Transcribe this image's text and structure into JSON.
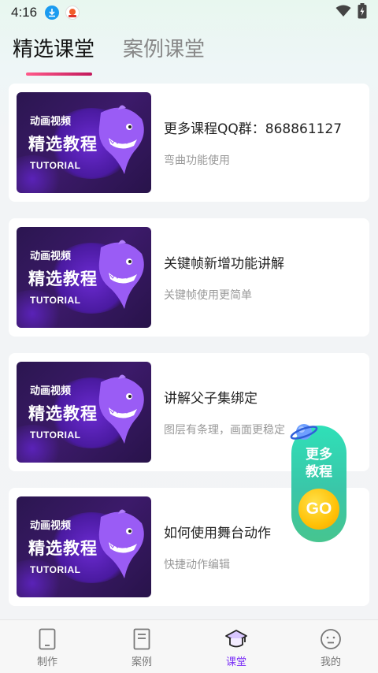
{
  "status_bar": {
    "time": "4:16",
    "icons": [
      "download-icon",
      "app-notification-icon",
      "wifi-icon",
      "battery-icon"
    ]
  },
  "tabs": [
    {
      "label": "精选课堂",
      "active": true
    },
    {
      "label": "案例课堂",
      "active": false
    }
  ],
  "thumbnail": {
    "line1": "动画视频",
    "line2": "精选教程",
    "line3": "TUTORIAL"
  },
  "courses": [
    {
      "title": "更多课程QQ群：868861127",
      "subtitle": "弯曲功能使用"
    },
    {
      "title": "关键帧新增功能讲解",
      "subtitle": "关键帧使用更简单"
    },
    {
      "title": "讲解父子集绑定",
      "subtitle": "图层有条理，画面更稳定"
    },
    {
      "title": "如何使用舞台动作",
      "subtitle": "快捷动作编辑"
    }
  ],
  "float_button": {
    "line1": "更多",
    "line2": "教程",
    "go": "GO"
  },
  "bottom_nav": [
    {
      "label": "制作",
      "icon": "tablet-icon",
      "active": false
    },
    {
      "label": "案例",
      "icon": "document-icon",
      "active": false
    },
    {
      "label": "课堂",
      "icon": "graduation-cap-icon",
      "active": true
    },
    {
      "label": "我的",
      "icon": "smiley-face-icon",
      "active": false
    }
  ],
  "colors": {
    "accent": "#7b2ff7",
    "tab_underline": "#e83e7a",
    "float_green": "#3ac6a8",
    "go_yellow": "#ffc107"
  }
}
